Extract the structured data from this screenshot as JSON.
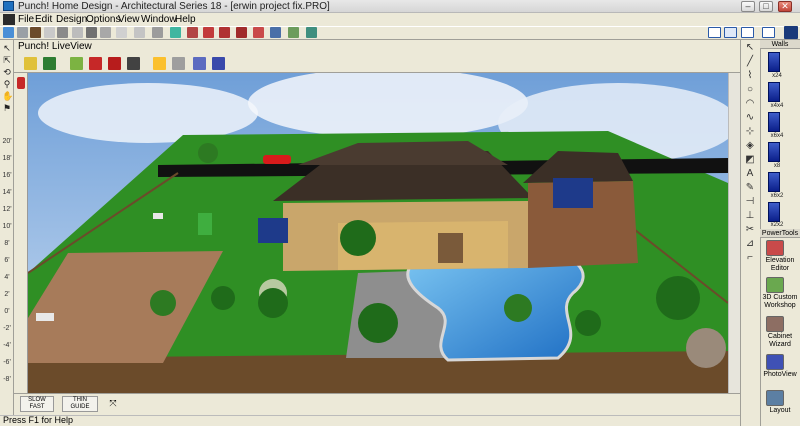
{
  "window": {
    "title": "Punch! Home Design - Architectural Series 18 - [erwin project fix.PRO]",
    "controls": {
      "minimize": "–",
      "maximize": "□",
      "close": "✕"
    }
  },
  "menu": [
    "File",
    "Edit",
    "Design",
    "Options",
    "View",
    "Window",
    "Help"
  ],
  "liveview": {
    "title": "Punch! LiveView"
  },
  "ruler": {
    "ticks": [
      "20'",
      "18'",
      "16'",
      "14'",
      "12'",
      "10'",
      "8'",
      "6'",
      "4'",
      "2'",
      "0'",
      "-2'",
      "-4'",
      "-6'",
      "-8'",
      "-10'",
      "-12'"
    ]
  },
  "nav": {
    "slow": "SLOW",
    "fast": "FAST",
    "thin": "THIN",
    "guide": "GUIDE"
  },
  "status": {
    "text": "Press F1 for Help"
  },
  "walls_panel": {
    "title": "Walls",
    "items": [
      "x24",
      "x4x4",
      "x6x4",
      "x8",
      "x6x2",
      "x2x2"
    ]
  },
  "powertools": {
    "title": "PowerTools",
    "items": [
      {
        "label": "Elevation Editor",
        "icon": "elevation-editor-icon"
      },
      {
        "label": "3D Custom Workshop",
        "icon": "3d-workshop-icon"
      },
      {
        "label": "Cabinet Wizard",
        "icon": "cabinet-wizard-icon"
      },
      {
        "label": "PhotoView",
        "icon": "photoview-icon"
      },
      {
        "label": "Layout",
        "icon": "layout-icon"
      }
    ]
  },
  "colors": {
    "chrome": "#ece9d8",
    "grass": "#2f8f24",
    "sky": "#8fb7e6",
    "roof": "#3b2f26",
    "pool": "#2e88d6"
  }
}
